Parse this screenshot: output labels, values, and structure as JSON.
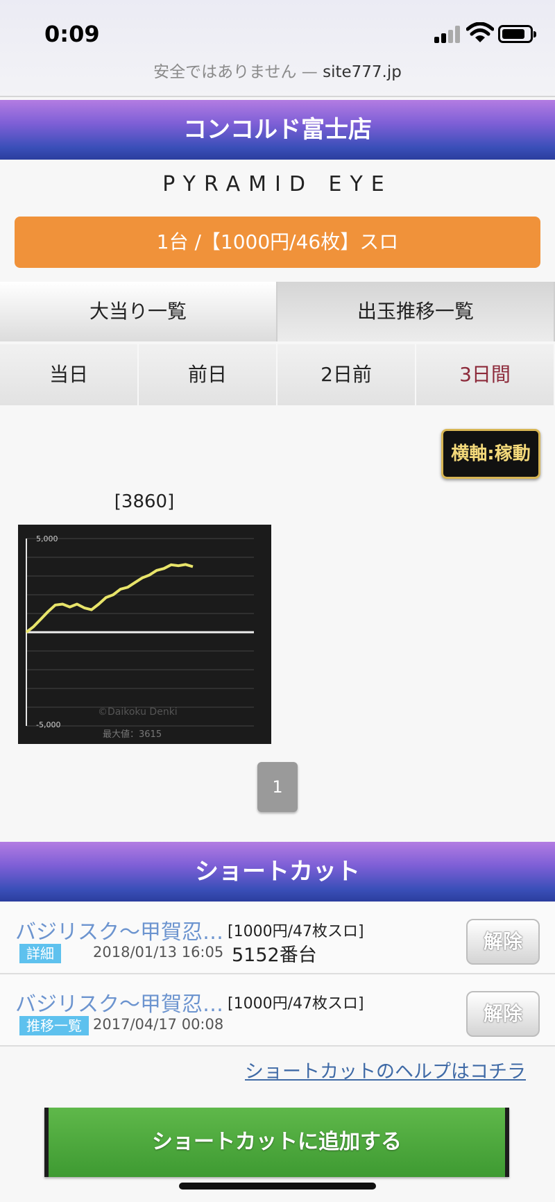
{
  "status": {
    "time": "0:09"
  },
  "address": {
    "insecure": "安全ではありません — ",
    "host": "site777.jp"
  },
  "header": {
    "title": "コンコルド富士店"
  },
  "machine": {
    "name": "PYRAMID EYE",
    "rate": "1台 /【1000円/46枚】スロ",
    "number_label": "[3860]"
  },
  "tabs": [
    {
      "label": "大当り一覧"
    },
    {
      "label": "出玉推移一覧"
    }
  ],
  "days": [
    {
      "label": "当日"
    },
    {
      "label": "前日"
    },
    {
      "label": "2日前"
    },
    {
      "label": "3日間"
    }
  ],
  "axis_toggle": {
    "label": "横軸:稼動"
  },
  "chart_data": {
    "type": "line",
    "ylim": [
      -5000,
      5000
    ],
    "ytick_labels": [
      "5,000",
      "-5,000"
    ],
    "watermark": "©Daikoku Denki",
    "max_label": "最大値：3615",
    "grid": true,
    "series": [
      {
        "color": "#e8e46a",
        "values": [
          0,
          300,
          700,
          1100,
          1450,
          1500,
          1350,
          1500,
          1300,
          1200,
          1500,
          1850,
          2000,
          2300,
          2400,
          2650,
          2900,
          3050,
          3300,
          3400,
          3600,
          3550,
          3615,
          3500
        ]
      }
    ]
  },
  "pager": {
    "current": "1"
  },
  "shortcut": {
    "title": "ショートカット",
    "items": [
      {
        "name": "バジリスク〜甲賀忍…",
        "rate": "[1000円/47枚スロ]",
        "tag": "詳細",
        "date": "2018/01/13 16:05",
        "number": "5152番台",
        "release": "解除"
      },
      {
        "name": "バジリスク〜甲賀忍…",
        "rate": "[1000円/47枚スロ]",
        "tag": "推移一覧",
        "date": "2017/04/17 00:08",
        "number": "",
        "release": "解除"
      }
    ],
    "help_link": "ショートカットのヘルプはコチラ",
    "add_button": "ショートカットに追加する"
  },
  "colors": {
    "accent_orange": "#f0923a",
    "header_purple": "#7d5fd6",
    "add_green": "#4caa3c"
  }
}
